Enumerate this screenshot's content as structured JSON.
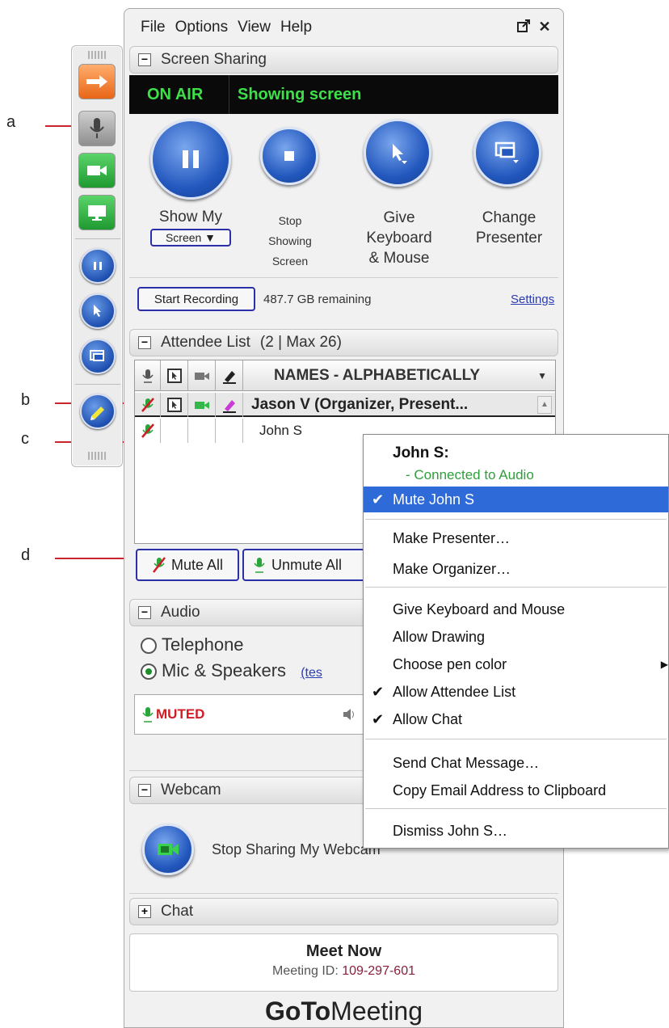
{
  "callouts": [
    "a",
    "b",
    "c",
    "d"
  ],
  "menubar": {
    "items": [
      "File",
      "Options",
      "View",
      "Help"
    ],
    "popout_icon": "popout-icon",
    "close_glyph": "✕"
  },
  "screen_sharing": {
    "title": "Screen Sharing",
    "toggle": "−",
    "on_air": "ON AIR",
    "status": "Showing screen",
    "buttons": {
      "show_my_line1": "Show My",
      "show_my_dropdown": "Screen ▼",
      "stop_line1": "Stop",
      "stop_line2": "Showing",
      "stop_line3": "Screen",
      "give_line1": "Give",
      "give_line2": "Keyboard",
      "give_line3": "& Mouse",
      "change_line1": "Change",
      "change_line2": "Presenter"
    },
    "start_recording": "Start Recording",
    "remaining": "487.7 GB remaining",
    "settings": "Settings"
  },
  "attendee_list": {
    "title": "Attendee List",
    "toggle": "−",
    "count": "(2 | Max 26)",
    "column_header": "NAMES - ALPHABETICALLY",
    "rows": [
      {
        "name": "Jason V (Organizer, Present..."
      },
      {
        "name": "John S"
      }
    ],
    "mute_all": "Mute All",
    "unmute_all": "Unmute All"
  },
  "audio": {
    "title": "Audio",
    "toggle": "−",
    "telephone": "Telephone",
    "mic_speakers": "Mic & Speakers",
    "test_link": "(tes",
    "muted": "MUTED",
    "selected": "mic_speakers"
  },
  "webcam": {
    "title": "Webcam",
    "toggle": "−",
    "stop_sharing": "Stop Sharing My Webcam"
  },
  "chat": {
    "title": "Chat",
    "toggle": "+"
  },
  "meeting": {
    "title": "Meet Now",
    "id_label": "Meeting ID:",
    "id_value": "109-297-601",
    "brand_bold": "GoTo",
    "brand_light": "Meeting"
  },
  "context_menu": {
    "header": "John S:",
    "status": "- Connected to Audio",
    "items": [
      {
        "label": "Mute John S",
        "checked": true
      },
      {
        "label": "Make Presenter…"
      },
      {
        "label": "Make Organizer…"
      },
      {
        "label": "Give Keyboard and Mouse"
      },
      {
        "label": "Allow Drawing"
      },
      {
        "label": "Choose pen color",
        "submenu_arrow": "▶"
      },
      {
        "label": "Allow Attendee List",
        "checked": true
      },
      {
        "label": "Allow Chat",
        "checked": true
      },
      {
        "label": "Send Chat Message…"
      },
      {
        "label": "Copy Email Address to Clipboard"
      },
      {
        "label": "Dismiss John S…"
      }
    ]
  },
  "colors": {
    "accent": "#2257bd",
    "onair_green": "#3ee04a",
    "selection": "#2f6bd8",
    "muted_red": "#d01c24",
    "callout_red": "#c8252e",
    "webcam_green": "#34b84a",
    "arrow_orange": "#f0782a"
  }
}
